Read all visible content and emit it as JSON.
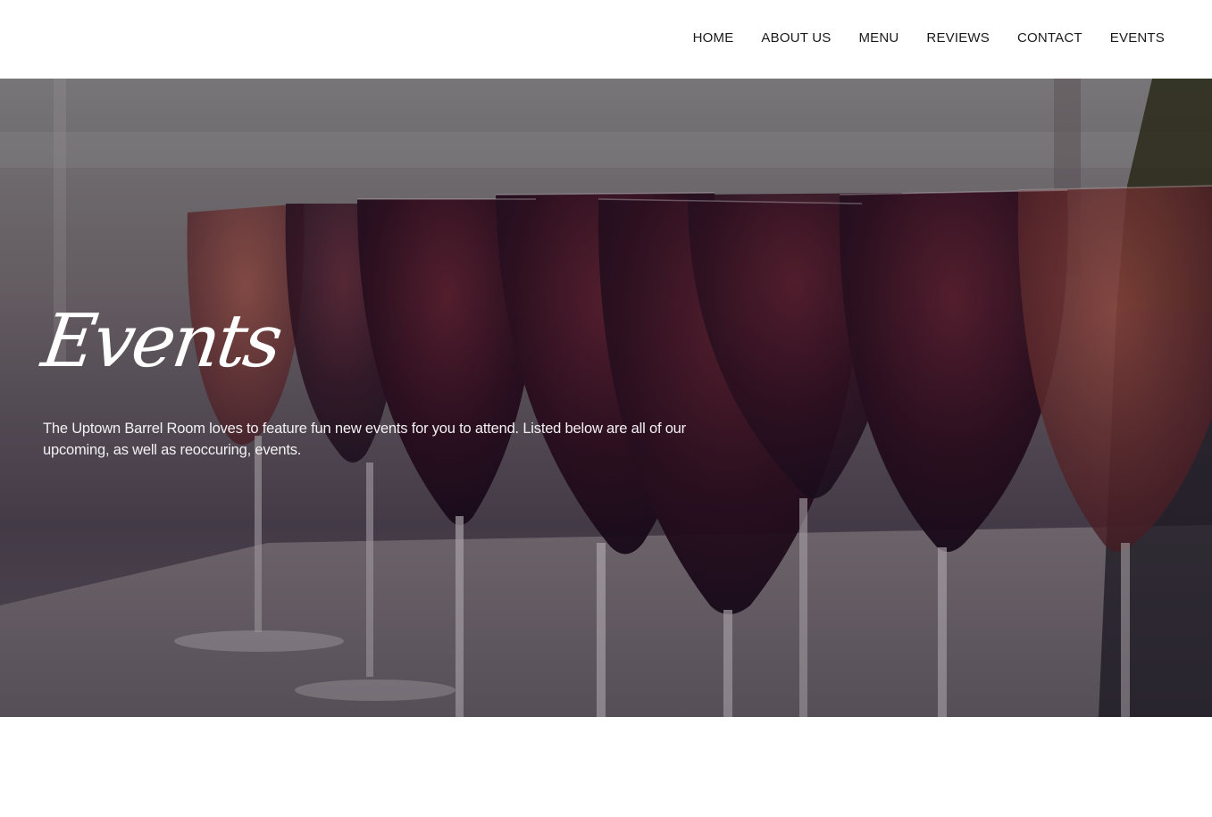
{
  "nav": {
    "items": [
      {
        "label": "HOME"
      },
      {
        "label": "ABOUT US"
      },
      {
        "label": "MENU"
      },
      {
        "label": "REVIEWS"
      },
      {
        "label": "CONTACT"
      },
      {
        "label": "EVENTS"
      }
    ]
  },
  "hero": {
    "title": "Events",
    "description": "The Uptown Barrel Room loves to feature fun new events for you to attend. Listed below are all of our upcoming, as well as reoccuring, events."
  },
  "colors": {
    "nav_text": "#1a1a1a",
    "hero_text": "#ffffff",
    "wine": "#3a1020"
  }
}
